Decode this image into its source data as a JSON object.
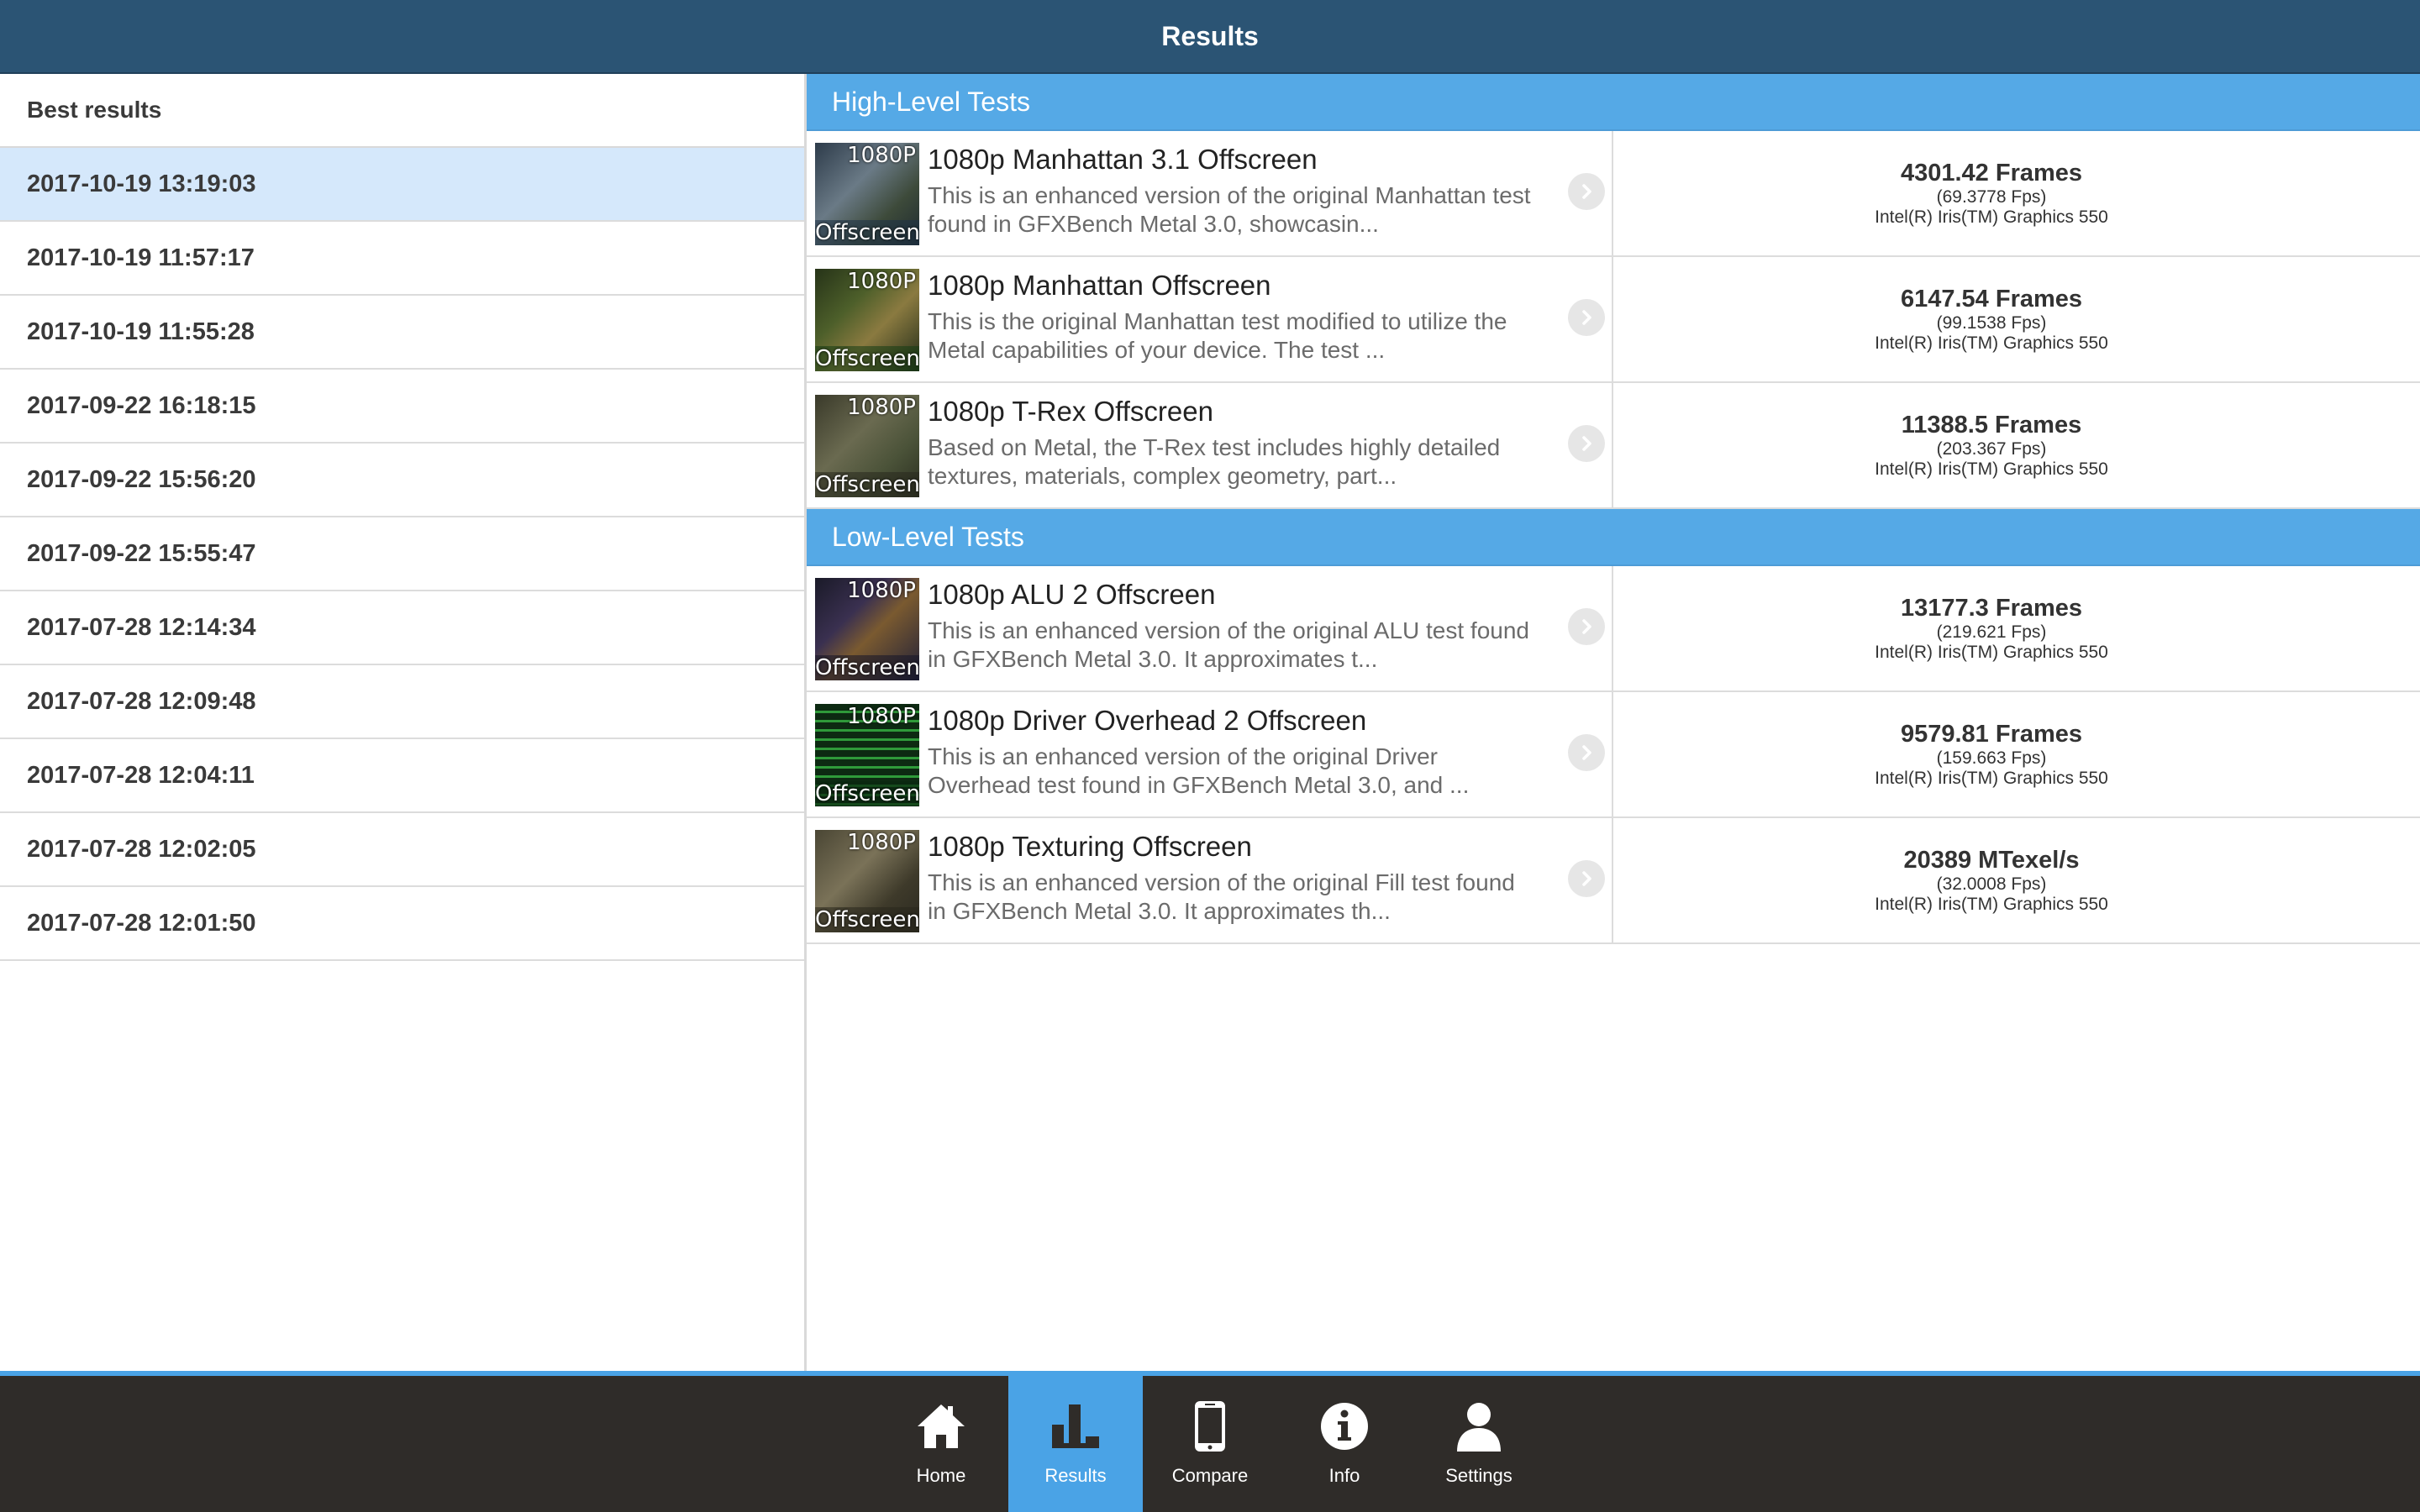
{
  "header": {
    "title": "Results"
  },
  "sidebar": {
    "title": "Best results",
    "items": [
      "2017-10-19 13:19:03",
      "2017-10-19 11:57:17",
      "2017-10-19 11:55:28",
      "2017-09-22 16:18:15",
      "2017-09-22 15:56:20",
      "2017-09-22 15:55:47",
      "2017-07-28 12:14:34",
      "2017-07-28 12:09:48",
      "2017-07-28 12:04:11",
      "2017-07-28 12:02:05",
      "2017-07-28 12:01:50"
    ]
  },
  "sections": [
    {
      "title": "High-Level Tests",
      "tests": [
        {
          "title": "1080p Manhattan 3.1 Offscreen",
          "desc_line1": "This is an enhanced version of the original Manhattan test",
          "desc_line2": "found in GFXBench Metal 3.0, showcasin...",
          "thumb_top": "1080P",
          "thumb_bottom": "Offscreen",
          "score": "4301.42 Frames",
          "fps": "(69.3778 Fps)",
          "gpu": "Intel(R) Iris(TM) Graphics 550"
        },
        {
          "title": "1080p Manhattan Offscreen",
          "desc_line1": "This is the original Manhattan test modified to utilize the",
          "desc_line2": "Metal capabilities of your device. The test ...",
          "thumb_top": "1080P",
          "thumb_bottom": "Offscreen",
          "score": "6147.54 Frames",
          "fps": "(99.1538 Fps)",
          "gpu": "Intel(R) Iris(TM) Graphics 550"
        },
        {
          "title": "1080p T-Rex Offscreen",
          "desc_line1": "Based on Metal, the T-Rex test includes highly detailed",
          "desc_line2": "textures, materials, complex geometry, part...",
          "thumb_top": "1080P",
          "thumb_bottom": "Offscreen",
          "score": "11388.5 Frames",
          "fps": "(203.367 Fps)",
          "gpu": "Intel(R) Iris(TM) Graphics 550"
        }
      ]
    },
    {
      "title": "Low-Level Tests",
      "tests": [
        {
          "title": "1080p ALU 2 Offscreen",
          "desc_line1": "This is an enhanced version of the original ALU test found",
          "desc_line2": "in GFXBench Metal 3.0. It approximates t...",
          "thumb_top": "1080P",
          "thumb_bottom": "Offscreen",
          "score": "13177.3 Frames",
          "fps": "(219.621 Fps)",
          "gpu": "Intel(R) Iris(TM) Graphics 550"
        },
        {
          "title": "1080p Driver Overhead 2 Offscreen",
          "desc_line1": "This is an enhanced version of the original Driver",
          "desc_line2": "Overhead test found in GFXBench Metal 3.0, and ...",
          "thumb_top": "1080P",
          "thumb_bottom": "Offscreen",
          "score": "9579.81 Frames",
          "fps": "(159.663 Fps)",
          "gpu": "Intel(R) Iris(TM) Graphics 550"
        },
        {
          "title": "1080p Texturing Offscreen",
          "desc_line1": "This is an enhanced version of the original Fill test found",
          "desc_line2": "in GFXBench Metal 3.0. It approximates th...",
          "thumb_top": "1080P",
          "thumb_bottom": "Offscreen",
          "score": "20389 MTexel/s",
          "fps": "(32.0008 Fps)",
          "gpu": "Intel(R) Iris(TM) Graphics 550"
        }
      ]
    }
  ],
  "tabs": [
    {
      "label": "Home",
      "icon": "home-icon"
    },
    {
      "label": "Results",
      "icon": "bar-chart-icon"
    },
    {
      "label": "Compare",
      "icon": "phone-icon"
    },
    {
      "label": "Info",
      "icon": "info-icon"
    },
    {
      "label": "Settings",
      "icon": "user-icon"
    }
  ],
  "active_tab": "Results",
  "colors": {
    "header": "#2b5474",
    "section": "#55a9e6",
    "selected_row": "#d5e8fb",
    "tabbar": "#2f2c29",
    "tab_active": "#4aa3e6"
  }
}
